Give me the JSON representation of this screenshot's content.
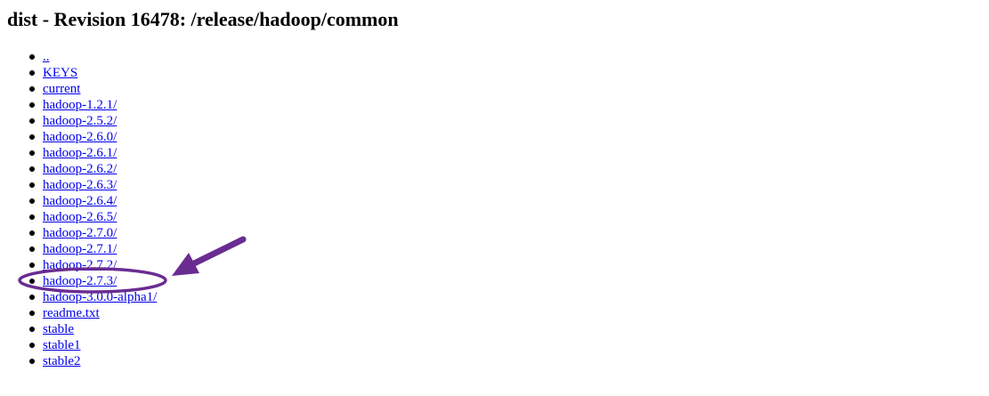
{
  "page": {
    "title": "dist - Revision 16478: /release/hadoop/common"
  },
  "entries": [
    {
      "label": ".."
    },
    {
      "label": "KEYS"
    },
    {
      "label": "current"
    },
    {
      "label": "hadoop-1.2.1/"
    },
    {
      "label": "hadoop-2.5.2/"
    },
    {
      "label": "hadoop-2.6.0/"
    },
    {
      "label": "hadoop-2.6.1/"
    },
    {
      "label": "hadoop-2.6.2/"
    },
    {
      "label": "hadoop-2.6.3/"
    },
    {
      "label": "hadoop-2.6.4/"
    },
    {
      "label": "hadoop-2.6.5/"
    },
    {
      "label": "hadoop-2.7.0/"
    },
    {
      "label": "hadoop-2.7.1/"
    },
    {
      "label": "hadoop-2.7.2/"
    },
    {
      "label": "hadoop-2.7.3/",
      "highlighted": true
    },
    {
      "label": "hadoop-3.0.0-alpha1/"
    },
    {
      "label": "readme.txt"
    },
    {
      "label": "stable"
    },
    {
      "label": "stable1"
    },
    {
      "label": "stable2"
    }
  ],
  "colors": {
    "link": "#0000ee",
    "annotation": "#6a2c91",
    "bullet": "#000000"
  },
  "annotation": {
    "highlight_icon": "ellipse-highlight",
    "pointer_icon": "arrow-pointer"
  }
}
